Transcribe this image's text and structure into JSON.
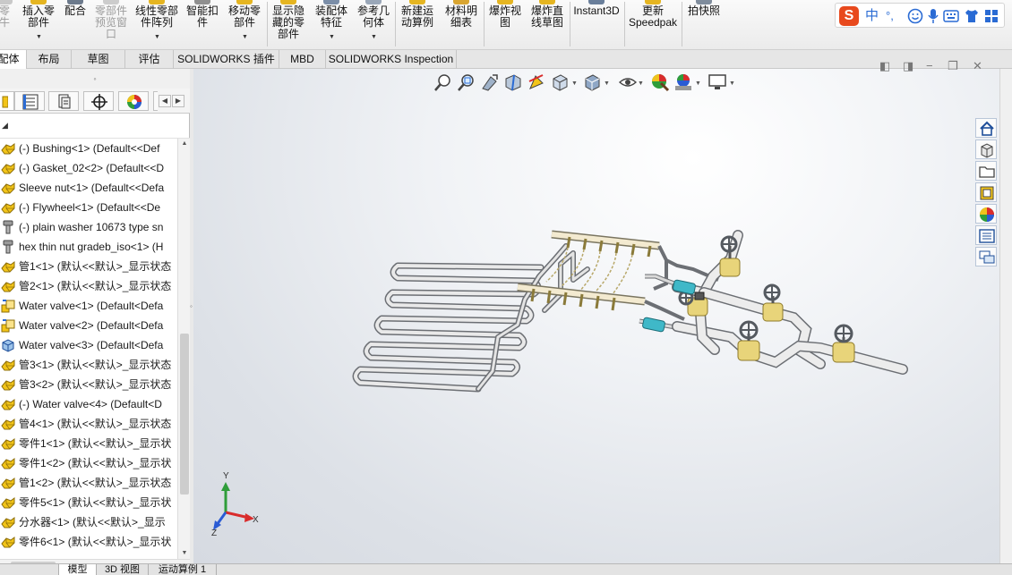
{
  "command_manager": {
    "buttons": [
      {
        "id": "partial-left",
        "label": "零\n牛",
        "disabled": true
      },
      {
        "id": "insert-components",
        "label": "插入零\n部件"
      },
      {
        "id": "mate",
        "label": "配合"
      },
      {
        "id": "component-preview",
        "label": "零部件\n预览窗\n口",
        "disabled": true
      },
      {
        "id": "linear-pattern",
        "label": "线性零部\n件阵列"
      },
      {
        "id": "smart-fasteners",
        "label": "智能扣\n件"
      },
      {
        "id": "move-component",
        "label": "移动零\n部件"
      },
      {
        "id": "show-hidden",
        "label": "显示隐\n藏的零\n部件"
      },
      {
        "id": "assembly-features",
        "label": "装配体\n特征"
      },
      {
        "id": "reference-geometry",
        "label": "参考几\n何体"
      },
      {
        "id": "new-motion-study",
        "label": "新建运\n动算例"
      },
      {
        "id": "bom",
        "label": "材料明\n细表"
      },
      {
        "id": "exploded-view",
        "label": "爆炸视\n图"
      },
      {
        "id": "explode-line-sketch",
        "label": "爆炸直\n线草图"
      },
      {
        "id": "instant3d",
        "label": "Instant3D"
      },
      {
        "id": "update-speedpak",
        "label": "更新\nSpeedpak"
      },
      {
        "id": "take-snapshot",
        "label": "拍快照"
      }
    ]
  },
  "ime": {
    "logo": "S",
    "lang": "中",
    "punct": "°,"
  },
  "tabs": [
    {
      "label": "配体",
      "active": true
    },
    {
      "label": "布局"
    },
    {
      "label": "草图"
    },
    {
      "label": "评估"
    },
    {
      "label": "SOLIDWORKS 插件"
    },
    {
      "label": "MBD"
    },
    {
      "label": "SOLIDWORKS Inspection"
    }
  ],
  "feature_tree": {
    "grip": "◦",
    "items": [
      {
        "label": "(-) Bushing<1> (Default<<Def",
        "icon": "part-icon"
      },
      {
        "label": "(-) Gasket_02<2> (Default<<D",
        "icon": "part-icon"
      },
      {
        "label": "Sleeve nut<1> (Default<<Defa",
        "icon": "part-icon"
      },
      {
        "label": "(-) Flywheel<1> (Default<<De",
        "icon": "part-icon"
      },
      {
        "label": "(-) plain washer 10673 type sn",
        "icon": "bolt-icon"
      },
      {
        "label": "hex thin nut gradeb_iso<1> (H",
        "icon": "bolt-icon"
      },
      {
        "label": "管1<1> (默认<<默认>_显示状态",
        "icon": "part-icon"
      },
      {
        "label": "管2<1> (默认<<默认>_显示状态",
        "icon": "part-icon"
      },
      {
        "label": "Water valve<1> (Default<Defa",
        "icon": "assembly-icon"
      },
      {
        "label": "Water valve<2> (Default<Defa",
        "icon": "assembly-icon"
      },
      {
        "label": "Water valve<3> (Default<Defa",
        "icon": "assembly-blue-icon"
      },
      {
        "label": "管3<1> (默认<<默认>_显示状态",
        "icon": "part-icon"
      },
      {
        "label": "管3<2> (默认<<默认>_显示状态",
        "icon": "part-icon"
      },
      {
        "label": "(-) Water valve<4> (Default<D",
        "icon": "part-icon"
      },
      {
        "label": "管4<1> (默认<<默认>_显示状态",
        "icon": "part-icon"
      },
      {
        "label": "零件1<1> (默认<<默认>_显示状",
        "icon": "part-icon"
      },
      {
        "label": "零件1<2> (默认<<默认>_显示状",
        "icon": "part-icon"
      },
      {
        "label": "管1<2> (默认<<默认>_显示状态",
        "icon": "part-icon"
      },
      {
        "label": "零件5<1> (默认<<默认>_显示状",
        "icon": "part-icon"
      },
      {
        "label": "分水器<1> (默认<<默认>_显示",
        "icon": "part-icon"
      },
      {
        "label": "零件6<1> (默认<<默认>_显示状",
        "icon": "part-icon"
      }
    ]
  },
  "triad": {
    "x": "X",
    "y": "Y",
    "z": "Z"
  },
  "bottom_tabs": [
    {
      "label": "模型",
      "active": true
    },
    {
      "label": "3D 视图"
    },
    {
      "label": "运动算例 1"
    }
  ],
  "colors": {
    "part_yellow": "#f2c418",
    "pipe": "#d9d9d9",
    "valve_brass": "#e8d47a",
    "valve_cyan": "#3fb8c8",
    "handwheel": "#555a60"
  }
}
